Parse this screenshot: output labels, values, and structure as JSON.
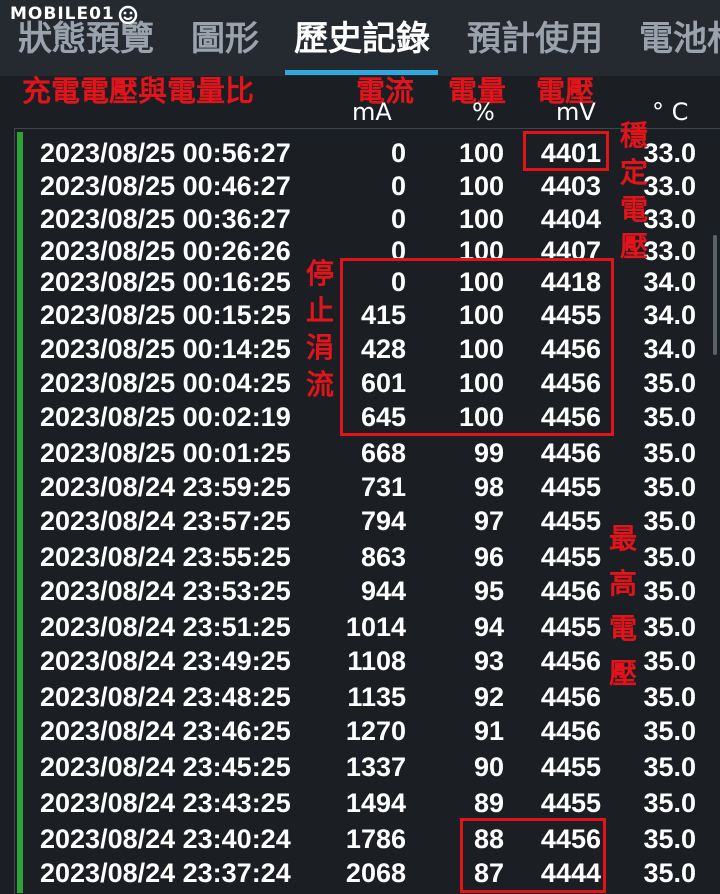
{
  "watermark": "MOBILE01",
  "tabs": [
    {
      "label": "狀態預覽"
    },
    {
      "label": "圖形"
    },
    {
      "label": "歷史記錄"
    },
    {
      "label": "預計使用"
    },
    {
      "label": "電池材"
    }
  ],
  "annotations": {
    "title": "充電電壓與電量比",
    "current": "電流",
    "capacity": "電量",
    "voltage": "電壓",
    "stable_voltage": [
      "穩",
      "定",
      "電",
      "壓"
    ],
    "stop_current": [
      "停",
      "止",
      "涓",
      "流"
    ],
    "max_voltage": [
      "最",
      "高",
      "電",
      "壓"
    ]
  },
  "units": {
    "current": "mA",
    "capacity": "%",
    "voltage": "mV",
    "temp": "° C"
  },
  "rows": [
    {
      "time": "2023/08/25 00:56:27",
      "ma": "0",
      "pct": "100",
      "mv": "4401",
      "temp": "33.0"
    },
    {
      "time": "2023/08/25 00:46:27",
      "ma": "0",
      "pct": "100",
      "mv": "4403",
      "temp": "33.0"
    },
    {
      "time": "2023/08/25 00:36:27",
      "ma": "0",
      "pct": "100",
      "mv": "4404",
      "temp": "33.0"
    },
    {
      "time": "2023/08/25 00:26:26",
      "ma": "0",
      "pct": "100",
      "mv": "4407",
      "temp": "33.0"
    },
    {
      "time": "2023/08/25 00:16:25",
      "ma": "0",
      "pct": "100",
      "mv": "4418",
      "temp": "34.0"
    },
    {
      "time": "2023/08/25 00:15:25",
      "ma": "415",
      "pct": "100",
      "mv": "4455",
      "temp": "34.0"
    },
    {
      "time": "2023/08/25 00:14:25",
      "ma": "428",
      "pct": "100",
      "mv": "4456",
      "temp": "34.0"
    },
    {
      "time": "2023/08/25 00:04:25",
      "ma": "601",
      "pct": "100",
      "mv": "4456",
      "temp": "35.0"
    },
    {
      "time": "2023/08/25 00:02:19",
      "ma": "645",
      "pct": "100",
      "mv": "4456",
      "temp": "35.0"
    },
    {
      "time": "2023/08/25 00:01:25",
      "ma": "668",
      "pct": "99",
      "mv": "4456",
      "temp": "35.0"
    },
    {
      "time": "2023/08/24 23:59:25",
      "ma": "731",
      "pct": "98",
      "mv": "4455",
      "temp": "35.0"
    },
    {
      "time": "2023/08/24 23:57:25",
      "ma": "794",
      "pct": "97",
      "mv": "4455",
      "temp": "35.0"
    },
    {
      "time": "2023/08/24 23:55:25",
      "ma": "863",
      "pct": "96",
      "mv": "4455",
      "temp": "35.0"
    },
    {
      "time": "2023/08/24 23:53:25",
      "ma": "944",
      "pct": "95",
      "mv": "4456",
      "temp": "35.0"
    },
    {
      "time": "2023/08/24 23:51:25",
      "ma": "1014",
      "pct": "94",
      "mv": "4455",
      "temp": "35.0"
    },
    {
      "time": "2023/08/24 23:49:25",
      "ma": "1108",
      "pct": "93",
      "mv": "4456",
      "temp": "35.0"
    },
    {
      "time": "2023/08/24 23:48:25",
      "ma": "1135",
      "pct": "92",
      "mv": "4456",
      "temp": "35.0"
    },
    {
      "time": "2023/08/24 23:46:25",
      "ma": "1270",
      "pct": "91",
      "mv": "4456",
      "temp": "35.0"
    },
    {
      "time": "2023/08/24 23:45:25",
      "ma": "1337",
      "pct": "90",
      "mv": "4455",
      "temp": "35.0"
    },
    {
      "time": "2023/08/24 23:43:25",
      "ma": "1494",
      "pct": "89",
      "mv": "4455",
      "temp": "35.0"
    },
    {
      "time": "2023/08/24 23:40:24",
      "ma": "1786",
      "pct": "88",
      "mv": "4456",
      "temp": "35.0"
    },
    {
      "time": "2023/08/24 23:37:24",
      "ma": "2068",
      "pct": "87",
      "mv": "4444",
      "temp": "35.0"
    }
  ]
}
